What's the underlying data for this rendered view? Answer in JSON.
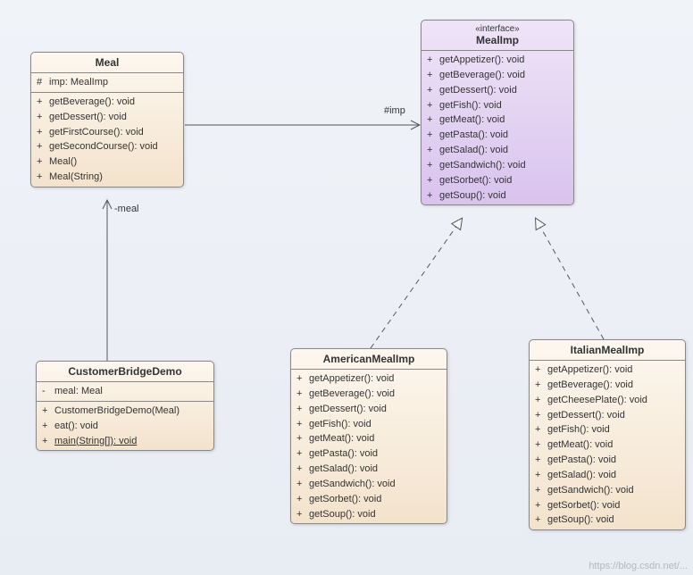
{
  "classes": {
    "meal": {
      "name": "Meal",
      "attrs": [
        {
          "vis": "#",
          "sig": "imp: MealImp"
        }
      ],
      "ops": [
        {
          "vis": "+",
          "sig": "getBeverage(): void"
        },
        {
          "vis": "+",
          "sig": "getDessert(): void"
        },
        {
          "vis": "+",
          "sig": "getFirstCourse(): void"
        },
        {
          "vis": "+",
          "sig": "getSecondCourse(): void"
        },
        {
          "vis": "+",
          "sig": "Meal()"
        },
        {
          "vis": "+",
          "sig": "Meal(String)"
        }
      ]
    },
    "mealimp": {
      "stereotype": "«interface»",
      "name": "MealImp",
      "ops": [
        {
          "vis": "+",
          "sig": "getAppetizer(): void"
        },
        {
          "vis": "+",
          "sig": "getBeverage(): void"
        },
        {
          "vis": "+",
          "sig": "getDessert(): void"
        },
        {
          "vis": "+",
          "sig": "getFish(): void"
        },
        {
          "vis": "+",
          "sig": "getMeat(): void"
        },
        {
          "vis": "+",
          "sig": "getPasta(): void"
        },
        {
          "vis": "+",
          "sig": "getSalad(): void"
        },
        {
          "vis": "+",
          "sig": "getSandwich(): void"
        },
        {
          "vis": "+",
          "sig": "getSorbet(): void"
        },
        {
          "vis": "+",
          "sig": "getSoup(): void"
        }
      ]
    },
    "customer": {
      "name": "CustomerBridgeDemo",
      "attrs": [
        {
          "vis": "-",
          "sig": "meal: Meal"
        }
      ],
      "ops": [
        {
          "vis": "+",
          "sig": "CustomerBridgeDemo(Meal)"
        },
        {
          "vis": "+",
          "sig": "eat(): void"
        },
        {
          "vis": "+",
          "sig": "main(String[]): void",
          "static": true
        }
      ]
    },
    "american": {
      "name": "AmericanMealImp",
      "ops": [
        {
          "vis": "+",
          "sig": "getAppetizer(): void"
        },
        {
          "vis": "+",
          "sig": "getBeverage(): void"
        },
        {
          "vis": "+",
          "sig": "getDessert(): void"
        },
        {
          "vis": "+",
          "sig": "getFish(): void"
        },
        {
          "vis": "+",
          "sig": "getMeat(): void"
        },
        {
          "vis": "+",
          "sig": "getPasta(): void"
        },
        {
          "vis": "+",
          "sig": "getSalad(): void"
        },
        {
          "vis": "+",
          "sig": "getSandwich(): void"
        },
        {
          "vis": "+",
          "sig": "getSorbet(): void"
        },
        {
          "vis": "+",
          "sig": "getSoup(): void"
        }
      ]
    },
    "italian": {
      "name": "ItalianMealImp",
      "ops": [
        {
          "vis": "+",
          "sig": "getAppetizer(): void"
        },
        {
          "vis": "+",
          "sig": "getBeverage(): void"
        },
        {
          "vis": "+",
          "sig": "getCheesePlate(): void"
        },
        {
          "vis": "+",
          "sig": "getDessert(): void"
        },
        {
          "vis": "+",
          "sig": "getFish(): void"
        },
        {
          "vis": "+",
          "sig": "getMeat(): void"
        },
        {
          "vis": "+",
          "sig": "getPasta(): void"
        },
        {
          "vis": "+",
          "sig": "getSalad(): void"
        },
        {
          "vis": "+",
          "sig": "getSandwich(): void"
        },
        {
          "vis": "+",
          "sig": "getSorbet(): void"
        },
        {
          "vis": "+",
          "sig": "getSoup(): void"
        }
      ]
    }
  },
  "labels": {
    "imp_assoc": "#imp",
    "meal_assoc": "-meal"
  },
  "watermark": "https://blog.csdn.net/..."
}
